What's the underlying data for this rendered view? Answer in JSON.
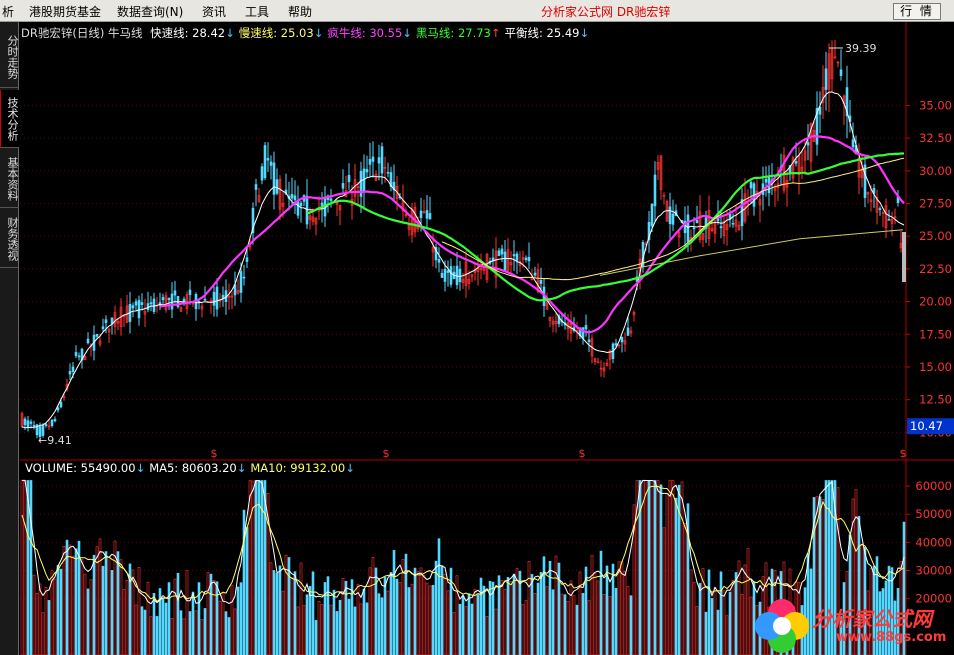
{
  "menu": {
    "items": [
      "析",
      "港股期货基金",
      "数据查询(N)",
      "资讯",
      "工具",
      "帮助"
    ],
    "title": "分析家公式网 DR驰宏锌",
    "quote_button": "行 情"
  },
  "side_tabs": [
    {
      "label": "分时走势",
      "active": false
    },
    {
      "label": "技术分析",
      "active": true
    },
    {
      "label": "基本资料",
      "active": false
    },
    {
      "label": "财务透视",
      "active": false
    }
  ],
  "price_legend": {
    "name": "DR驰宏锌(日线)",
    "indicator": "牛马线",
    "items": [
      {
        "label": "快速线: 28.42",
        "color": "#ffffff",
        "arrow": "↓",
        "arrow_color": "#4fc8ff"
      },
      {
        "label": "慢速线: 25.03",
        "color": "#ffff66",
        "arrow": "↓",
        "arrow_color": "#4fc8ff"
      },
      {
        "label": "疯牛线: 30.55",
        "color": "#ff44ff",
        "arrow": "↓",
        "arrow_color": "#4fc8ff"
      },
      {
        "label": "黑马线: 27.73",
        "color": "#33ff33",
        "arrow": "↑",
        "arrow_color": "#ff4444"
      },
      {
        "label": "平衡线: 25.49",
        "color": "#ffffff",
        "arrow": "↓",
        "arrow_color": "#4fc8ff"
      }
    ]
  },
  "volume_legend": {
    "items": [
      {
        "label": "VOLUME: 55490.00",
        "color": "#ffffff",
        "arrow": "↓",
        "arrow_color": "#4fc8ff"
      },
      {
        "label": "MA5: 80603.20",
        "color": "#ffffff",
        "arrow": "↓",
        "arrow_color": "#4fc8ff"
      },
      {
        "label": "MA10: 99132.00",
        "color": "#ffff66",
        "arrow": "↓",
        "arrow_color": "#4fc8ff"
      }
    ]
  },
  "price_axis": {
    "ticks": [
      "35.00",
      "32.50",
      "30.00",
      "27.50",
      "25.00",
      "22.50",
      "20.00",
      "17.50",
      "15.00",
      "12.50",
      "10.00"
    ],
    "current_price": "10.47",
    "high_label": "39.39",
    "low_label": "9.41"
  },
  "volume_axis": {
    "ticks": [
      "60000",
      "50000",
      "40000",
      "30000",
      "20000"
    ]
  },
  "chart_data": {
    "type": "candlestick",
    "panels": [
      "price",
      "volume"
    ],
    "price_range": [
      8.5,
      40
    ],
    "volume_range": [
      0,
      65000
    ],
    "high": 39.39,
    "low": 9.41,
    "last": 10.47,
    "indicators": {
      "快速线": 28.42,
      "慢速线": 25.03,
      "疯牛线": 30.55,
      "黑马线": 27.73,
      "平衡线": 25.49
    },
    "volume": 55490.0,
    "MA5": 80603.2,
    "MA10": 99132.0
  },
  "colors": {
    "up": "#ff3232",
    "down": "#54d8ff",
    "grid": "#8b0000",
    "axis_text": "#ff3232"
  },
  "logo": {
    "text": "分析家公式网",
    "url": "www.88gs.com"
  }
}
